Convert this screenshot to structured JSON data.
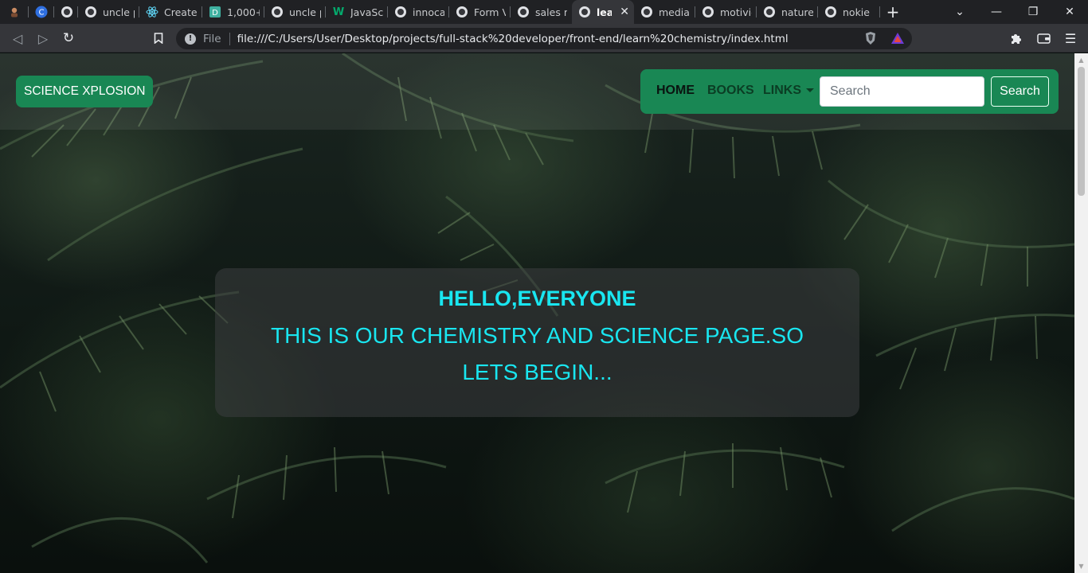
{
  "browser": {
    "tabs": [
      {
        "title": "",
        "icon": "profile-icon"
      },
      {
        "title": "",
        "icon": "canva-icon"
      },
      {
        "title": "",
        "icon": "globe-icon"
      },
      {
        "title": "uncle p",
        "icon": "globe-icon"
      },
      {
        "title": "Create a",
        "icon": "react-icon"
      },
      {
        "title": "1,000+",
        "icon": "dash-icon"
      },
      {
        "title": "uncle p",
        "icon": "globe-icon"
      },
      {
        "title": "JavaScr",
        "icon": "w3-icon"
      },
      {
        "title": "innocal",
        "icon": "globe-icon"
      },
      {
        "title": "Form Va",
        "icon": "globe-icon"
      },
      {
        "title": "sales m",
        "icon": "globe-icon"
      },
      {
        "title": "lear",
        "icon": "globe-icon",
        "active": true
      },
      {
        "title": "media",
        "icon": "globe-icon"
      },
      {
        "title": "motivie",
        "icon": "globe-icon"
      },
      {
        "title": "nature",
        "icon": "globe-icon"
      },
      {
        "title": "nokie",
        "icon": "globe-icon"
      }
    ],
    "address_scheme_label": "File",
    "url": "file:///C:/Users/User/Desktop/projects/full-stack%20developer/front-end/learn%20chemistry/index.html"
  },
  "page": {
    "brand": "SCIENCE XPLOSION",
    "nav": {
      "home": "HOME",
      "books": "BOOKS",
      "links": "LINKS"
    },
    "search": {
      "placeholder": "Search",
      "button_label": "Search"
    },
    "hero": {
      "heading": "HELLO,EVERYONE",
      "text": "THIS IS OUR CHEMISTRY AND SCIENCE PAGE.SO LETS BEGIN..."
    }
  },
  "colors": {
    "brand_green": "#198754",
    "hero_text": "#19e6f0"
  }
}
